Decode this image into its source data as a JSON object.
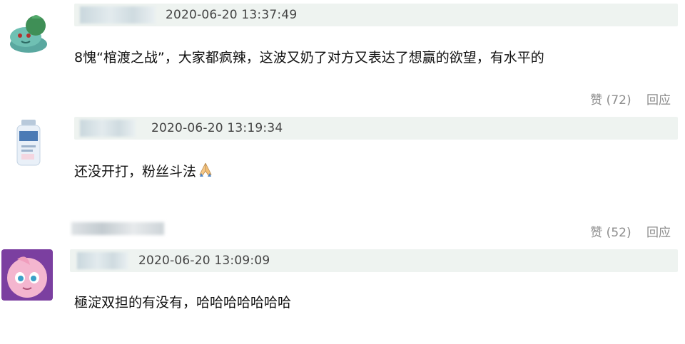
{
  "comments": [
    {
      "timestamp": "2020-06-20 13:37:49",
      "text": "8愧“棺渡之战”，大家都疯辣，这波又奶了对方又表达了想赢的欲望，有水平的",
      "like_label": "赞 (72)",
      "reply_label": "回应",
      "avatar_icon": "bulbasaur-avatar-icon"
    },
    {
      "timestamp": "2020-06-20 13:19:34",
      "text": "还没开打，粉丝斗法",
      "emoji_icon": "folded-hands-icon",
      "like_label": "赞 (52)",
      "reply_label": "回应",
      "avatar_icon": "bottle-avatar-icon"
    },
    {
      "timestamp": "2020-06-20 13:09:09",
      "text": "極淀双担的有没有，哈哈哈哈哈哈哈",
      "avatar_icon": "jigglypuff-avatar-icon"
    }
  ],
  "colors": {
    "meta_bar_bg": "#eef3f0",
    "action_text": "#8c8c8c"
  }
}
